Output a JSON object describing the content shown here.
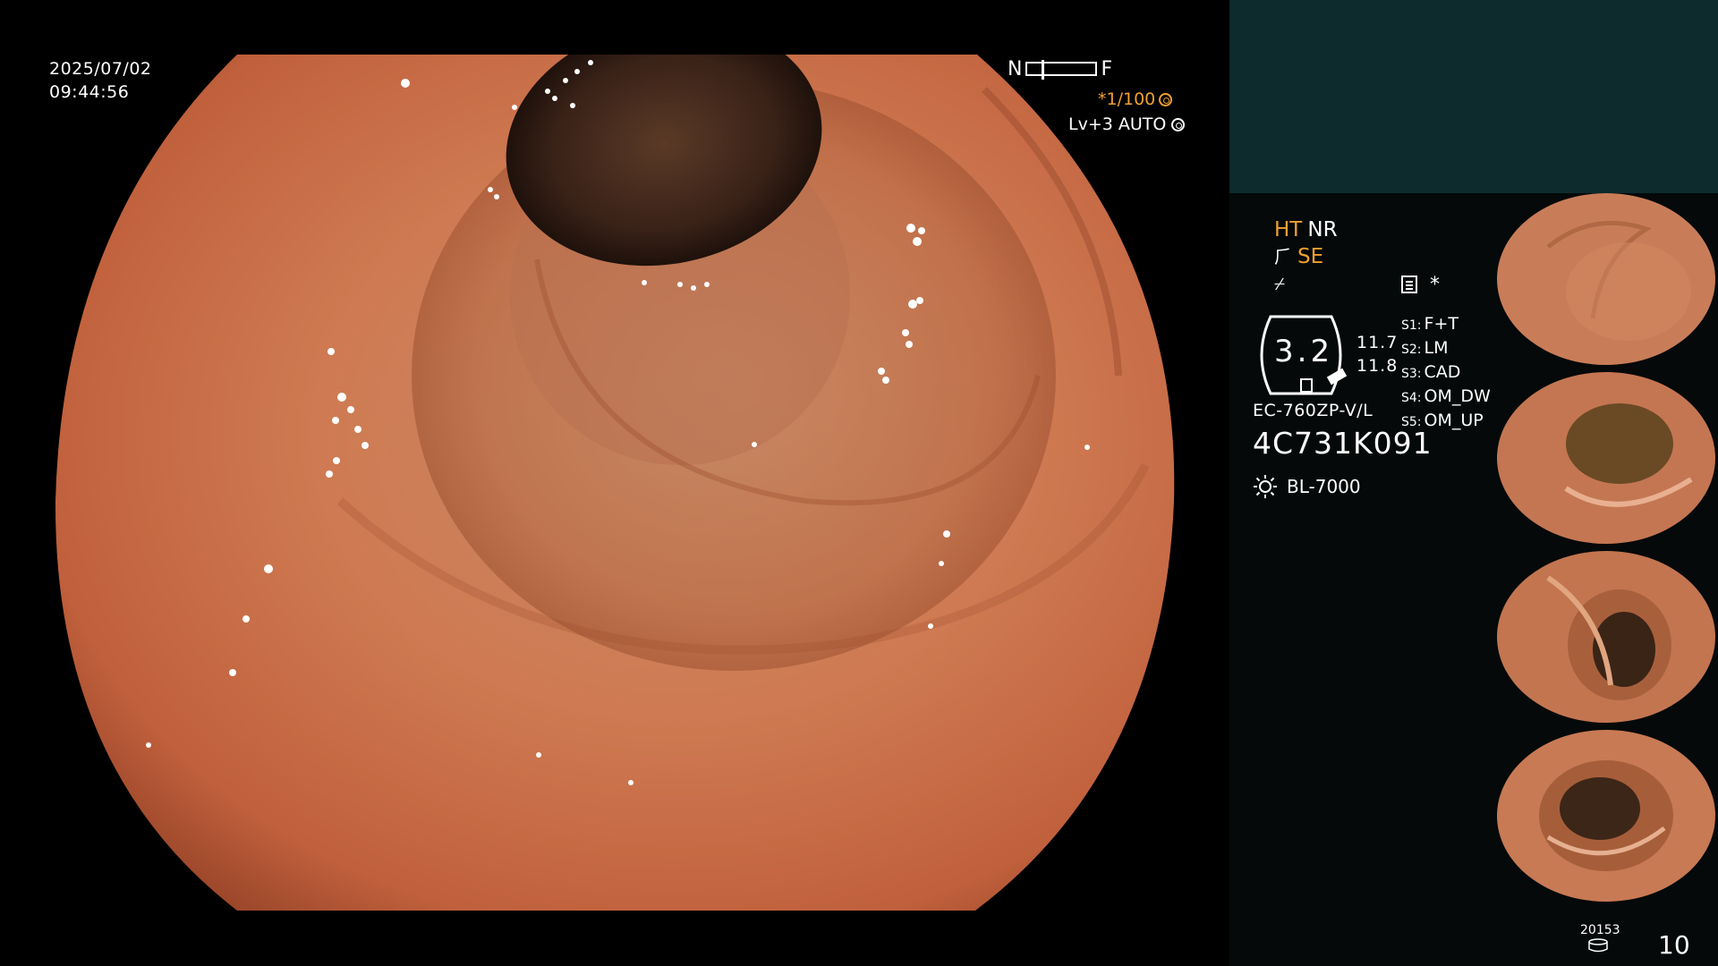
{
  "view": {
    "date": "2025/07/02",
    "time": "09:44:56",
    "nf_near": "N",
    "nf_far": "F",
    "shutter": "*1/100",
    "level": "Lv+3",
    "auto": "AUTO"
  },
  "panel": {
    "mode_ht": "HT",
    "mode_nr": "NR",
    "mode_se": "SE",
    "star": "*",
    "gauge_value": "3.2",
    "gauge_upper": "11.7",
    "gauge_lower": "11.8",
    "settings": [
      {
        "key": "S1:",
        "value": "F+T"
      },
      {
        "key": "S2:",
        "value": "LM"
      },
      {
        "key": "S3:",
        "value": "CAD"
      },
      {
        "key": "S4:",
        "value": "OM_DW"
      },
      {
        "key": "S5:",
        "value": "OM_UP"
      }
    ],
    "scope_model": "EC-760ZP-V/L",
    "scope_serial": "4C731K091",
    "light_source": "BL-7000",
    "image_count_small": "20153",
    "image_count": "10"
  },
  "colors": {
    "mucosa": "#c96a45",
    "lumen": "#3a2218",
    "panel_top": "#0d2a2c",
    "panel": "#050909",
    "accent_orange": "#f0a030"
  },
  "icons": [
    "sun-icon",
    "database-icon",
    "menu-icon",
    "ring-icon",
    "scissors-icon",
    "lightning-icon"
  ]
}
